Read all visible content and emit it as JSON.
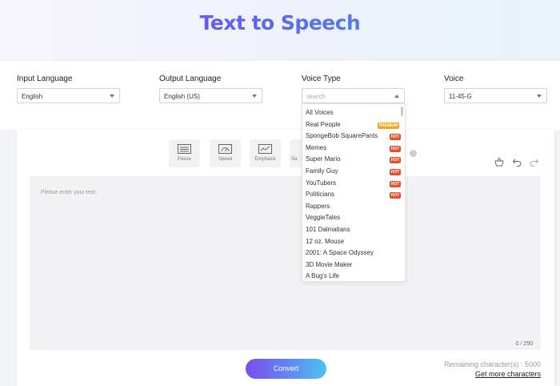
{
  "hero": {
    "title": "Text to Speech"
  },
  "controls": {
    "input_language": {
      "label": "Input Language",
      "value": "English"
    },
    "output_language": {
      "label": "Output Language",
      "value": "English (US)"
    },
    "voice_type": {
      "label": "Voice Type",
      "placeholder": "search"
    },
    "voice": {
      "label": "Voice",
      "value": "11-45-G"
    }
  },
  "toolbar": {
    "pause_label": "Pause",
    "speed_label": "Speed",
    "emphasis_label": "Emphasis",
    "fourth_label_partial": "Sa",
    "info_symbol": "!"
  },
  "editor": {
    "placeholder": "Please enter your text.",
    "counter": "0 / 250"
  },
  "footer": {
    "convert_label": "Convert",
    "remaining": "Remaining character(s) : 5000",
    "more_chars_link": "Get more characters"
  },
  "voice_type_dropdown": {
    "items": [
      {
        "label": "All Voices",
        "badge": ""
      },
      {
        "label": "Real People",
        "badge": "PREMIUM"
      },
      {
        "label": "SpongeBob SquarePants",
        "badge": "HOT"
      },
      {
        "label": "Memes",
        "badge": "HOT"
      },
      {
        "label": "Super Mario",
        "badge": "HOT"
      },
      {
        "label": "Family Guy",
        "badge": "HOT"
      },
      {
        "label": "YouTubers",
        "badge": "HOT"
      },
      {
        "label": "Politicians",
        "badge": "HOT"
      },
      {
        "label": "Rappers",
        "badge": ""
      },
      {
        "label": "VeggieTales",
        "badge": ""
      },
      {
        "label": "101 Dalmatians",
        "badge": ""
      },
      {
        "label": "12 oz. Mouse",
        "badge": ""
      },
      {
        "label": "2001: A Space Odyssey",
        "badge": ""
      },
      {
        "label": "3D Movie Maker",
        "badge": ""
      },
      {
        "label": "A Bug's Life",
        "badge": ""
      }
    ]
  },
  "colors": {
    "hot_badge": "#e8502a",
    "premium_badge": "#f2a51a",
    "convert_gradient_start": "#7b4df0",
    "convert_gradient_end": "#4cc3f2"
  }
}
